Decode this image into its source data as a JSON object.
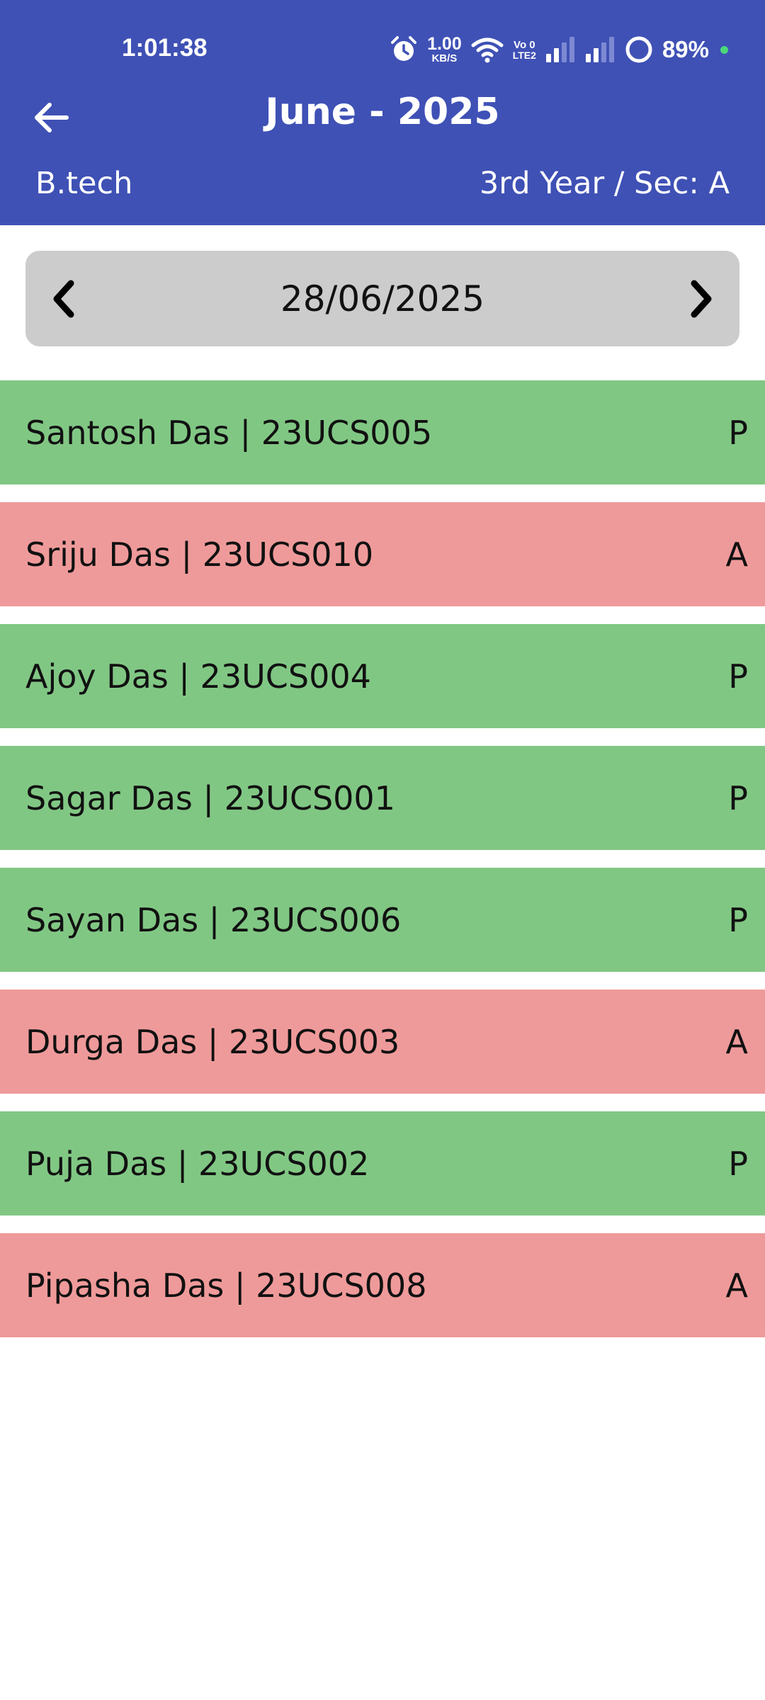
{
  "status_bar": {
    "time": "1:01:38",
    "net_speed_value": "1.00",
    "net_speed_unit": "KB/S",
    "volte_top": "Vo 0",
    "volte_bottom": "LTE2",
    "battery": "89%",
    "icons": [
      "alarm-icon",
      "wifi-icon",
      "signal-icon",
      "signal-icon",
      "battery-ring-icon"
    ]
  },
  "header": {
    "title": "June - 2025",
    "course": "B.tech",
    "year_section": "3rd Year / Sec: A",
    "back_icon": "arrow-left-icon"
  },
  "date_nav": {
    "date": "28/06/2025",
    "prev_icon": "chevron-left-icon",
    "next_icon": "chevron-right-icon"
  },
  "students": [
    {
      "label": "Santosh Das | 23UCS005",
      "status": "P"
    },
    {
      "label": "Sriju Das | 23UCS010",
      "status": "A"
    },
    {
      "label": "Ajoy Das | 23UCS004",
      "status": "P"
    },
    {
      "label": "Sagar Das | 23UCS001",
      "status": "P"
    },
    {
      "label": "Sayan Das | 23UCS006",
      "status": "P"
    },
    {
      "label": "Durga Das | 23UCS003",
      "status": "A"
    },
    {
      "label": "Puja Das | 23UCS002",
      "status": "P"
    },
    {
      "label": "Pipasha Das | 23UCS008",
      "status": "A"
    }
  ],
  "colors": {
    "header_bg": "#3f51b5",
    "present_bg": "#81c784",
    "absent_bg": "#ef9a9a",
    "date_nav_bg": "#cccccc"
  }
}
